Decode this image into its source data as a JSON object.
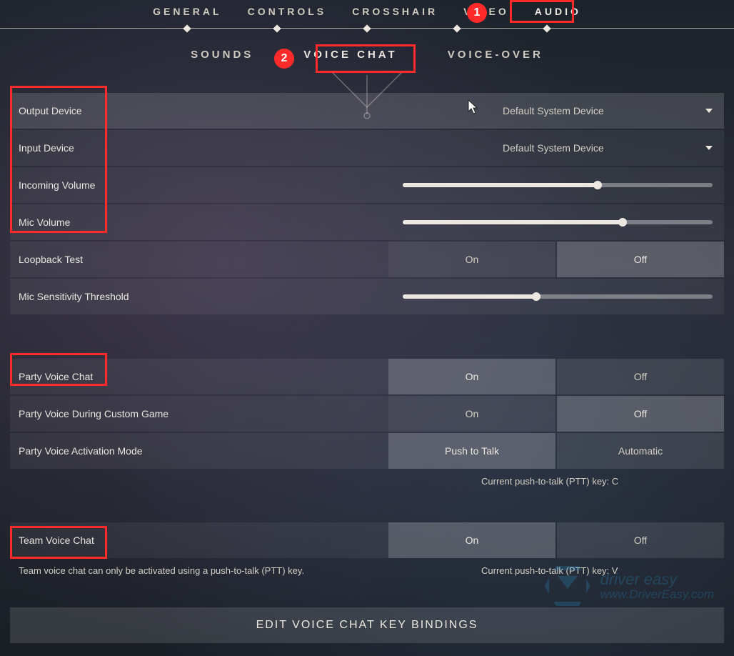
{
  "mainTabs": {
    "general": "GENERAL",
    "controls": "CONTROLS",
    "crosshair": "CROSSHAIR",
    "video": "VIDEO",
    "audio": "AUDIO"
  },
  "subTabs": {
    "sounds": "SOUNDS",
    "voiceChat": "VOICE CHAT",
    "voiceOver": "VOICE-OVER"
  },
  "annotations": {
    "badge1": "1",
    "badge2": "2"
  },
  "rows": {
    "outputDevice": {
      "label": "Output Device",
      "value": "Default System Device"
    },
    "inputDevice": {
      "label": "Input Device",
      "value": "Default System Device"
    },
    "incomingVolume": {
      "label": "Incoming Volume",
      "percent": 63
    },
    "micVolume": {
      "label": "Mic Volume",
      "percent": 71
    },
    "loopbackTest": {
      "label": "Loopback Test",
      "on": "On",
      "off": "Off"
    },
    "micSensitivity": {
      "label": "Mic Sensitivity Threshold",
      "percent": 43
    },
    "partyVoiceChat": {
      "label": "Party Voice Chat",
      "on": "On",
      "off": "Off"
    },
    "partyVoiceDuringCustom": {
      "label": "Party Voice During Custom Game",
      "on": "On",
      "off": "Off"
    },
    "partyVoiceActivation": {
      "label": "Party Voice Activation Mode",
      "left": "Push to Talk",
      "right": "Automatic"
    },
    "teamVoiceChat": {
      "label": "Team Voice Chat",
      "on": "On",
      "off": "Off"
    }
  },
  "hints": {
    "partyPtt": "Current push-to-talk (PTT) key: C",
    "teamDesc": "Team voice chat can only be activated using a push-to-talk (PTT) key.",
    "teamPtt": "Current push-to-talk (PTT) key: V"
  },
  "editBindings": "EDIT VOICE CHAT KEY BINDINGS",
  "watermark": {
    "line1": "driver easy",
    "line2": "www.DriverEasy.com"
  }
}
